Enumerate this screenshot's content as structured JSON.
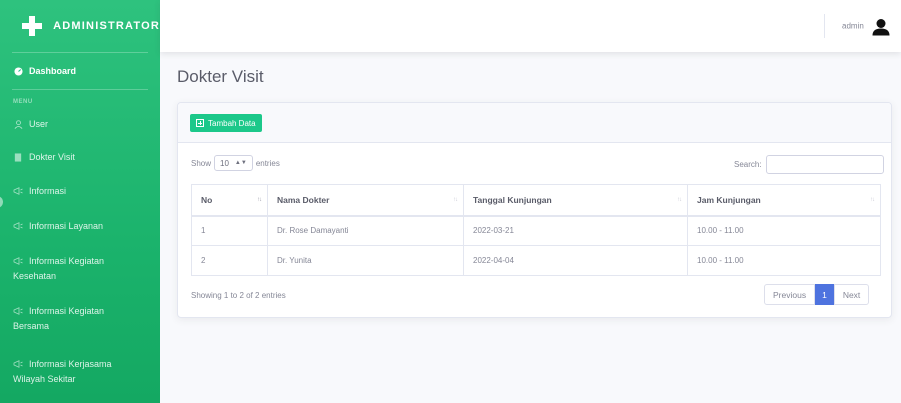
{
  "brand": {
    "title": "ADMINISTRATOR"
  },
  "sidebar": {
    "heading": "MENU",
    "dashboard": "Dashboard",
    "items": [
      {
        "label": "User",
        "icon": "user-icon"
      },
      {
        "label": "Dokter Visit",
        "icon": "file-icon"
      },
      {
        "label": "Informasi",
        "icon": "megaphone-icon"
      },
      {
        "label": "Informasi Layanan",
        "icon": "megaphone-icon"
      },
      {
        "label": "Informasi Kegiatan",
        "label2": "Kesehatan",
        "icon": "megaphone-icon"
      },
      {
        "label": "Informasi Kegiatan",
        "label2": "Bersama",
        "icon": "megaphone-icon"
      },
      {
        "label": "Informasi Kerjasama",
        "label2": "Wilayah Sekitar",
        "icon": "megaphone-icon"
      }
    ]
  },
  "topbar": {
    "username": "admin"
  },
  "page": {
    "title": "Dokter Visit"
  },
  "card": {
    "add_button": "Tambah Data",
    "show_label": "Show",
    "entries_label": "entries",
    "length_value": "10",
    "search_label": "Search:",
    "search_value": ""
  },
  "table": {
    "columns": [
      "No",
      "Nama Dokter",
      "Tanggal Kunjungan",
      "Jam Kunjungan"
    ],
    "rows": [
      [
        "1",
        "Dr. Rose Damayanti",
        "2022-03-21",
        "10.00 - 11.00"
      ],
      [
        "2",
        "Dr. Yunita",
        "2022-04-04",
        "10.00 - 11.00"
      ]
    ]
  },
  "footer": {
    "info": "Showing 1 to 2 of 2 entries",
    "previous": "Previous",
    "current_page": "1",
    "next": "Next"
  },
  "colors": {
    "sidebar": "#1cc88a",
    "primary": "#4e73df",
    "success": "#1cc88a"
  }
}
